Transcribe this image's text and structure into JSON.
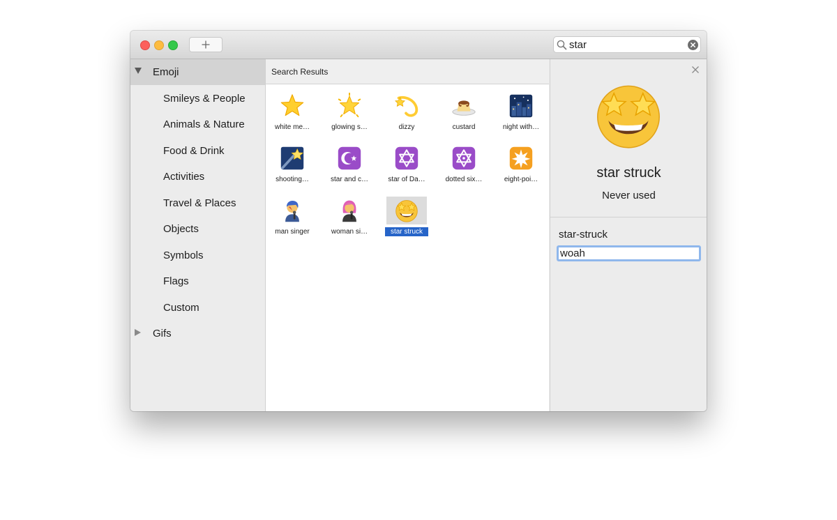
{
  "search": {
    "value": "star"
  },
  "sidebar": {
    "groups": [
      {
        "label": "Emoji",
        "expanded": true,
        "selected": true
      },
      {
        "label": "Gifs",
        "expanded": false,
        "selected": false
      }
    ],
    "categories": [
      "Smileys & People",
      "Animals & Nature",
      "Food & Drink",
      "Activities",
      "Travel & Places",
      "Objects",
      "Symbols",
      "Flags",
      "Custom"
    ]
  },
  "results": {
    "header": "Search Results",
    "items": [
      {
        "label": "white me…",
        "icon": "white-medium-star",
        "selected": false
      },
      {
        "label": "glowing s…",
        "icon": "glowing-star",
        "selected": false
      },
      {
        "label": "dizzy",
        "icon": "dizzy",
        "selected": false
      },
      {
        "label": "custard",
        "icon": "custard",
        "selected": false
      },
      {
        "label": "night with…",
        "icon": "night-with-stars",
        "selected": false
      },
      {
        "label": "shooting…",
        "icon": "shooting-star",
        "selected": false
      },
      {
        "label": "star and c…",
        "icon": "star-and-crescent",
        "selected": false
      },
      {
        "label": "star of Da…",
        "icon": "star-of-david",
        "selected": false
      },
      {
        "label": "dotted six…",
        "icon": "dotted-six-pointed-star",
        "selected": false
      },
      {
        "label": "eight-poi…",
        "icon": "eight-pointed-star",
        "selected": false
      },
      {
        "label": "man singer",
        "icon": "man-singer",
        "selected": false
      },
      {
        "label": "woman si…",
        "icon": "woman-singer",
        "selected": false
      },
      {
        "label": "star struck",
        "icon": "star-struck",
        "selected": true
      }
    ]
  },
  "detail": {
    "name": "star struck",
    "usage": "Never used",
    "shortname": "star-struck",
    "tag_value": "woah"
  },
  "colors": {
    "selection": "#2664c8",
    "focus_ring": "#8fb7ec",
    "close_red": "#fc605c",
    "minimize_yellow": "#fdbc40",
    "zoom_green": "#34c84a"
  }
}
